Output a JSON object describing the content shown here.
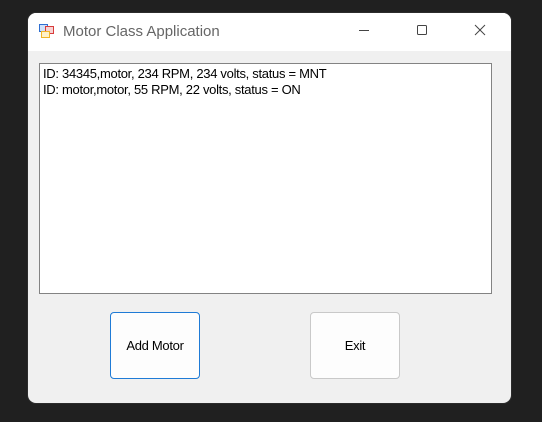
{
  "window": {
    "title": "Motor Class Application",
    "title_icon": "winforms-app-icon",
    "controls": {
      "minimize_icon": "minimize-icon",
      "maximize_icon": "maximize-icon",
      "close_icon": "close-icon"
    }
  },
  "motor_list": {
    "items": [
      "ID: 34345,motor, 234 RPM, 234 volts, status = MNT",
      "ID: motor,motor, 55 RPM, 22 volts, status = ON"
    ]
  },
  "buttons": {
    "add_motor_label": "Add Motor",
    "exit_label": "Exit"
  },
  "colors": {
    "accent_focus_border": "#1f7bd6",
    "window_background": "#f0f0f0",
    "desktop_background": "#202020"
  }
}
